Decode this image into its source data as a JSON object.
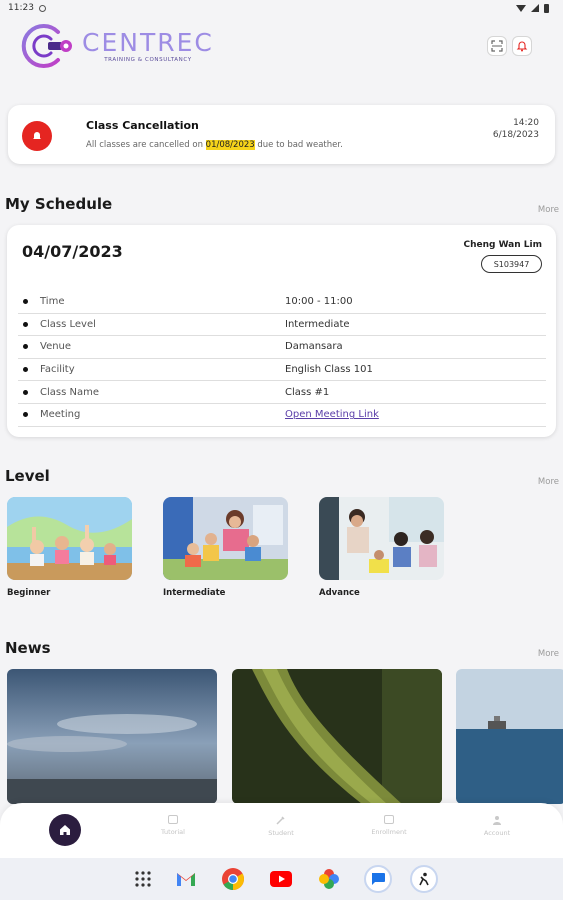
{
  "status_bar": {
    "time": "11:23"
  },
  "brand": {
    "name": "CENTREC",
    "tagline": "TRAINING & CONSULTANCY",
    "color": "#9d8ce4"
  },
  "header_icons": [
    "scan-icon",
    "bell-icon"
  ],
  "notice": {
    "title": "Class Cancellation",
    "body_prefix": "All classes are cancelled on ",
    "body_highlight": "01/08/2023",
    "body_suffix": " due to bad weather.",
    "time": "14:20",
    "date": "6/18/2023",
    "accent_color": "#e52521"
  },
  "schedule": {
    "title": "My Schedule",
    "more": "More",
    "date": "04/07/2023",
    "student_name": "Cheng Wan Lim",
    "student_id": "S103947",
    "rows": [
      {
        "label": "Time",
        "value": "10:00 - 11:00"
      },
      {
        "label": "Class Level",
        "value": "Intermediate"
      },
      {
        "label": "Venue",
        "value": "Damansara"
      },
      {
        "label": "Facility",
        "value": "English Class 101"
      },
      {
        "label": "Class Name",
        "value": "Class #1"
      },
      {
        "label": "Meeting",
        "value": "Open Meeting Link"
      }
    ]
  },
  "level": {
    "title": "Level",
    "more": "More",
    "items": [
      {
        "label": "Beginner"
      },
      {
        "label": "Intermediate"
      },
      {
        "label": "Advance"
      }
    ]
  },
  "news": {
    "title": "News",
    "more": "More"
  },
  "bottom_nav": {
    "items": [
      {
        "label": "Home",
        "icon": "home-icon"
      },
      {
        "label": "Tutorial",
        "icon": "book-icon"
      },
      {
        "label": "Student",
        "icon": "pencil-icon"
      },
      {
        "label": "Enrollment",
        "icon": "enroll-icon"
      },
      {
        "label": "Account",
        "icon": "person-icon"
      }
    ],
    "active_color": "#2b1d3f"
  },
  "dock": {
    "apps": [
      "apps-grid-icon",
      "gmail-icon",
      "chrome-icon",
      "youtube-icon",
      "photos-icon",
      "messages-icon",
      "app-icon"
    ]
  }
}
